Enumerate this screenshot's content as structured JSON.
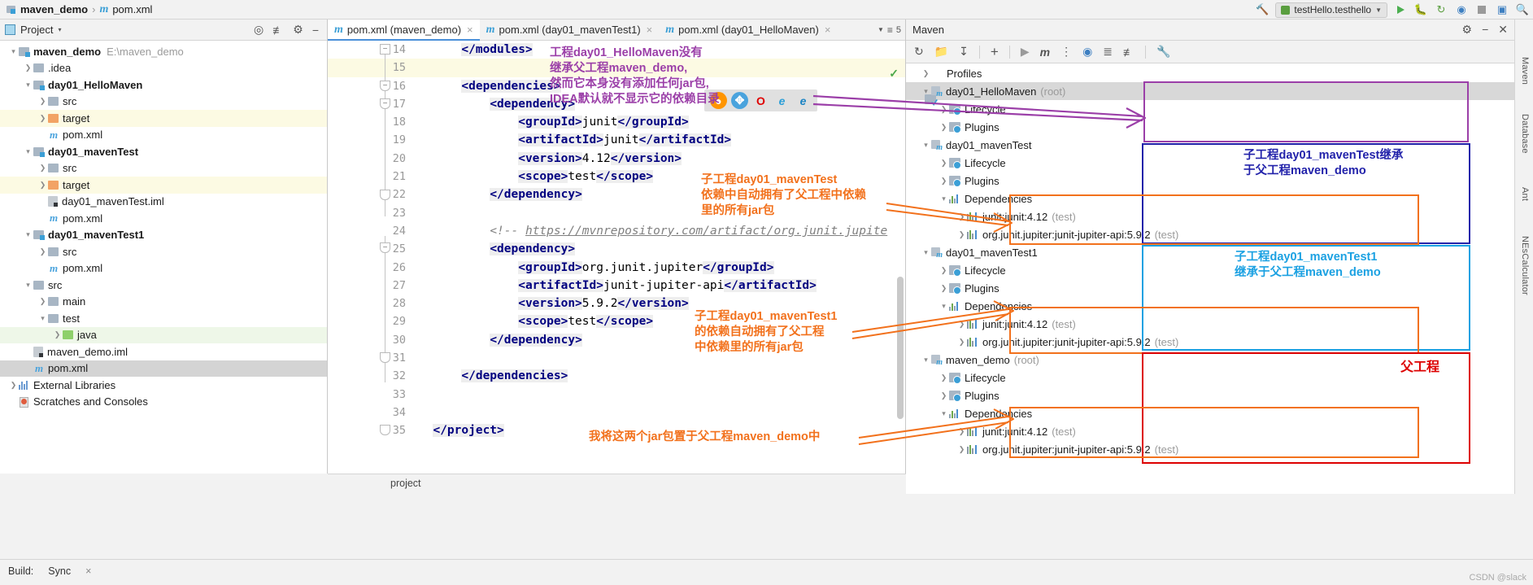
{
  "topbar": {
    "breadcrumb_project": "maven_demo",
    "breadcrumb_sep": "›",
    "breadcrumb_file": "pom.xml",
    "run_config": "testHello.testhello",
    "icons": [
      "hammer-icon",
      "run-button",
      "debug-button",
      "rerun-button",
      "coverage-button",
      "stop-button",
      "layout-button",
      "search-everywhere-icon"
    ]
  },
  "project_panel": {
    "title": "Project",
    "chevron": "▾",
    "tree": [
      {
        "indent": 0,
        "arrow": "v",
        "icon": "module",
        "label": "maven_demo",
        "bold": true,
        "path": "E:\\maven_demo",
        "hl": ""
      },
      {
        "indent": 1,
        "arrow": ">",
        "icon": "folder",
        "label": ".idea",
        "bold": false,
        "path": "",
        "hl": ""
      },
      {
        "indent": 1,
        "arrow": "v",
        "icon": "module",
        "label": "day01_HelloMaven",
        "bold": true,
        "path": "",
        "hl": ""
      },
      {
        "indent": 2,
        "arrow": ">",
        "icon": "folder",
        "label": "src",
        "bold": false,
        "path": "",
        "hl": ""
      },
      {
        "indent": 2,
        "arrow": ">",
        "icon": "folder-orange",
        "label": "target",
        "bold": false,
        "path": "",
        "hl": "yellow"
      },
      {
        "indent": 2,
        "arrow": "",
        "icon": "maven-file",
        "label": "pom.xml",
        "bold": false,
        "path": "",
        "hl": ""
      },
      {
        "indent": 1,
        "arrow": "v",
        "icon": "module",
        "label": "day01_mavenTest",
        "bold": true,
        "path": "",
        "hl": ""
      },
      {
        "indent": 2,
        "arrow": ">",
        "icon": "folder",
        "label": "src",
        "bold": false,
        "path": "",
        "hl": ""
      },
      {
        "indent": 2,
        "arrow": ">",
        "icon": "folder-orange",
        "label": "target",
        "bold": false,
        "path": "",
        "hl": "yellow"
      },
      {
        "indent": 2,
        "arrow": "",
        "icon": "iml-file",
        "label": "day01_mavenTest.iml",
        "bold": false,
        "path": "",
        "hl": ""
      },
      {
        "indent": 2,
        "arrow": "",
        "icon": "maven-file",
        "label": "pom.xml",
        "bold": false,
        "path": "",
        "hl": ""
      },
      {
        "indent": 1,
        "arrow": "v",
        "icon": "module",
        "label": "day01_mavenTest1",
        "bold": true,
        "path": "",
        "hl": ""
      },
      {
        "indent": 2,
        "arrow": ">",
        "icon": "folder",
        "label": "src",
        "bold": false,
        "path": "",
        "hl": ""
      },
      {
        "indent": 2,
        "arrow": "",
        "icon": "maven-file",
        "label": "pom.xml",
        "bold": false,
        "path": "",
        "hl": ""
      },
      {
        "indent": 1,
        "arrow": "v",
        "icon": "folder",
        "label": "src",
        "bold": false,
        "path": "",
        "hl": ""
      },
      {
        "indent": 2,
        "arrow": ">",
        "icon": "folder",
        "label": "main",
        "bold": false,
        "path": "",
        "hl": ""
      },
      {
        "indent": 2,
        "arrow": "v",
        "icon": "folder",
        "label": "test",
        "bold": false,
        "path": "",
        "hl": ""
      },
      {
        "indent": 3,
        "arrow": ">",
        "icon": "folder-green",
        "label": "java",
        "bold": false,
        "path": "",
        "hl": "green"
      },
      {
        "indent": 1,
        "arrow": "",
        "icon": "iml-file",
        "label": "maven_demo.iml",
        "bold": false,
        "path": "",
        "hl": ""
      },
      {
        "indent": 1,
        "arrow": "",
        "icon": "maven-file",
        "label": "pom.xml",
        "bold": false,
        "path": "",
        "hl": "sel"
      },
      {
        "indent": 0,
        "arrow": ">",
        "icon": "library",
        "label": "External Libraries",
        "bold": false,
        "path": "",
        "hl": ""
      },
      {
        "indent": 0,
        "arrow": "",
        "icon": "scratch",
        "label": "Scratches and Consoles",
        "bold": false,
        "path": "",
        "hl": ""
      }
    ]
  },
  "editor": {
    "tabs": [
      {
        "label": "pom.xml (maven_demo)",
        "active": true,
        "close": "×"
      },
      {
        "label": "pom.xml (day01_mavenTest1)",
        "active": false,
        "close": "×"
      },
      {
        "label": "pom.xml (day01_HelloMaven)",
        "active": false,
        "close": "×"
      }
    ],
    "tab_overflow_count": "5",
    "status_text": "project",
    "inspection_check": "✓",
    "browsers": [
      "firefox",
      "safari",
      "opera",
      "edge-legacy",
      "edge"
    ],
    "lines": [
      {
        "n": "14",
        "cur": false,
        "indent": 3,
        "segs": [
          {
            "t": "</modules>",
            "c": "tg",
            "bg": true
          }
        ]
      },
      {
        "n": "15",
        "cur": true,
        "indent": 0,
        "segs": []
      },
      {
        "n": "16",
        "cur": false,
        "indent": 3,
        "segs": [
          {
            "t": "<dependencies>",
            "c": "tg",
            "bg": true
          }
        ]
      },
      {
        "n": "17",
        "cur": false,
        "indent": 5,
        "segs": [
          {
            "t": "<dependency>",
            "c": "tg",
            "bg": true
          }
        ]
      },
      {
        "n": "18",
        "cur": false,
        "indent": 7,
        "segs": [
          {
            "t": "<groupId>",
            "c": "tg",
            "bg": true
          },
          {
            "t": "junit",
            "c": "txt",
            "bg": false
          },
          {
            "t": "</groupId>",
            "c": "tg",
            "bg": true
          }
        ]
      },
      {
        "n": "19",
        "cur": false,
        "indent": 7,
        "segs": [
          {
            "t": "<artifactId>",
            "c": "tg",
            "bg": true
          },
          {
            "t": "junit",
            "c": "txt",
            "bg": false
          },
          {
            "t": "</artifactId>",
            "c": "tg",
            "bg": true
          }
        ]
      },
      {
        "n": "20",
        "cur": false,
        "indent": 7,
        "segs": [
          {
            "t": "<version>",
            "c": "tg",
            "bg": true
          },
          {
            "t": "4.12",
            "c": "txt",
            "bg": false
          },
          {
            "t": "</version>",
            "c": "tg",
            "bg": true
          }
        ]
      },
      {
        "n": "21",
        "cur": false,
        "indent": 7,
        "segs": [
          {
            "t": "<scope>",
            "c": "tg",
            "bg": true
          },
          {
            "t": "test",
            "c": "txt",
            "bg": false
          },
          {
            "t": "</scope>",
            "c": "tg",
            "bg": true
          }
        ]
      },
      {
        "n": "22",
        "cur": false,
        "indent": 5,
        "segs": [
          {
            "t": "</dependency>",
            "c": "tg",
            "bg": true
          }
        ]
      },
      {
        "n": "23",
        "cur": false,
        "indent": 0,
        "segs": []
      },
      {
        "n": "24",
        "cur": false,
        "indent": 5,
        "segs": [
          {
            "t": "<!-- ",
            "c": "cmt",
            "bg": false
          },
          {
            "t": "https://mvnrepository.com/artifact/org.junit.jupite",
            "c": "lnk",
            "bg": false
          }
        ]
      },
      {
        "n": "25",
        "cur": false,
        "indent": 5,
        "segs": [
          {
            "t": "<dependency>",
            "c": "tg",
            "bg": true
          }
        ]
      },
      {
        "n": "26",
        "cur": false,
        "indent": 7,
        "segs": [
          {
            "t": "<groupId>",
            "c": "tg",
            "bg": true
          },
          {
            "t": "org.junit.jupiter",
            "c": "txt",
            "bg": false
          },
          {
            "t": "</groupId>",
            "c": "tg",
            "bg": true
          }
        ]
      },
      {
        "n": "27",
        "cur": false,
        "indent": 7,
        "segs": [
          {
            "t": "<artifactId>",
            "c": "tg",
            "bg": true
          },
          {
            "t": "junit-jupiter-api",
            "c": "txt",
            "bg": false
          },
          {
            "t": "</artifactId>",
            "c": "tg",
            "bg": true
          }
        ]
      },
      {
        "n": "28",
        "cur": false,
        "indent": 7,
        "segs": [
          {
            "t": "<version>",
            "c": "tg",
            "bg": true
          },
          {
            "t": "5.9.2",
            "c": "txt",
            "bg": false
          },
          {
            "t": "</version>",
            "c": "tg",
            "bg": true
          }
        ]
      },
      {
        "n": "29",
        "cur": false,
        "indent": 7,
        "segs": [
          {
            "t": "<scope>",
            "c": "tg",
            "bg": true
          },
          {
            "t": "test",
            "c": "txt",
            "bg": false
          },
          {
            "t": "</scope>",
            "c": "tg",
            "bg": true
          }
        ]
      },
      {
        "n": "30",
        "cur": false,
        "indent": 5,
        "segs": [
          {
            "t": "</dependency>",
            "c": "tg",
            "bg": true
          }
        ]
      },
      {
        "n": "31",
        "cur": false,
        "indent": 0,
        "segs": []
      },
      {
        "n": "32",
        "cur": false,
        "indent": 3,
        "segs": [
          {
            "t": "</dependencies>",
            "c": "tg",
            "bg": true
          }
        ]
      },
      {
        "n": "33",
        "cur": false,
        "indent": 0,
        "segs": []
      },
      {
        "n": "34",
        "cur": false,
        "indent": 0,
        "segs": []
      },
      {
        "n": "35",
        "cur": false,
        "indent": 1,
        "segs": [
          {
            "t": "</project>",
            "c": "tg",
            "bg": true
          }
        ]
      }
    ]
  },
  "maven_panel": {
    "title": "Maven",
    "toolbar_icons": [
      "reload-icon",
      "add-module-icon",
      "download-sources-icon",
      "plus-icon",
      "run-icon",
      "maven-goal-icon",
      "skip-tests-icon",
      "toggle-offline-icon",
      "expand-all-icon",
      "collapse-all-icon",
      "settings-wrench-icon"
    ],
    "tree": [
      {
        "indent": 0,
        "arrow": ">",
        "icon": "profiles",
        "label": "Profiles",
        "suffix": "",
        "sel": false
      },
      {
        "indent": 0,
        "arrow": "v",
        "icon": "module",
        "label": "day01_HelloMaven",
        "suffix": "(root)",
        "sel": true
      },
      {
        "indent": 1,
        "arrow": ">",
        "icon": "gear-folder",
        "label": "Lifecycle",
        "suffix": "",
        "sel": false
      },
      {
        "indent": 1,
        "arrow": ">",
        "icon": "gear-folder",
        "label": "Plugins",
        "suffix": "",
        "sel": false
      },
      {
        "indent": 0,
        "arrow": "v",
        "icon": "module",
        "label": "day01_mavenTest",
        "suffix": "",
        "sel": false
      },
      {
        "indent": 1,
        "arrow": ">",
        "icon": "gear-folder",
        "label": "Lifecycle",
        "suffix": "",
        "sel": false
      },
      {
        "indent": 1,
        "arrow": ">",
        "icon": "gear-folder",
        "label": "Plugins",
        "suffix": "",
        "sel": false
      },
      {
        "indent": 1,
        "arrow": "v",
        "icon": "deps-folder",
        "label": "Dependencies",
        "suffix": "",
        "sel": false
      },
      {
        "indent": 2,
        "arrow": ">",
        "icon": "jar",
        "label": "junit:junit:4.12",
        "suffix": "(test)",
        "sel": false
      },
      {
        "indent": 2,
        "arrow": ">",
        "icon": "jar",
        "label": "org.junit.jupiter:junit-jupiter-api:5.9.2",
        "suffix": "(test)",
        "sel": false
      },
      {
        "indent": 0,
        "arrow": "v",
        "icon": "module",
        "label": "day01_mavenTest1",
        "suffix": "",
        "sel": false
      },
      {
        "indent": 1,
        "arrow": ">",
        "icon": "gear-folder",
        "label": "Lifecycle",
        "suffix": "",
        "sel": false
      },
      {
        "indent": 1,
        "arrow": ">",
        "icon": "gear-folder",
        "label": "Plugins",
        "suffix": "",
        "sel": false
      },
      {
        "indent": 1,
        "arrow": "v",
        "icon": "deps-folder",
        "label": "Dependencies",
        "suffix": "",
        "sel": false
      },
      {
        "indent": 2,
        "arrow": ">",
        "icon": "jar",
        "label": "junit:junit:4.12",
        "suffix": "(test)",
        "sel": false
      },
      {
        "indent": 2,
        "arrow": ">",
        "icon": "jar",
        "label": "org.junit.jupiter:junit-jupiter-api:5.9.2",
        "suffix": "(test)",
        "sel": false
      },
      {
        "indent": 0,
        "arrow": "v",
        "icon": "module",
        "label": "maven_demo",
        "suffix": "(root)",
        "sel": false
      },
      {
        "indent": 1,
        "arrow": ">",
        "icon": "gear-folder",
        "label": "Lifecycle",
        "suffix": "",
        "sel": false
      },
      {
        "indent": 1,
        "arrow": ">",
        "icon": "gear-folder",
        "label": "Plugins",
        "suffix": "",
        "sel": false
      },
      {
        "indent": 1,
        "arrow": "v",
        "icon": "deps-folder",
        "label": "Dependencies",
        "suffix": "",
        "sel": false
      },
      {
        "indent": 2,
        "arrow": ">",
        "icon": "jar",
        "label": "junit:junit:4.12",
        "suffix": "(test)",
        "sel": false
      },
      {
        "indent": 2,
        "arrow": ">",
        "icon": "jar",
        "label": "org.junit.jupiter:junit-jupiter-api:5.9.2",
        "suffix": "(test)",
        "sel": false
      }
    ]
  },
  "annotations": {
    "purple_note": "工程day01_HelloMaven没有\n继承父工程maven_demo,\n然而它本身没有添加任何jar包,\nIDEA默认就不显示它的依赖目录",
    "orange_note_test": "子工程day01_mavenTest\n依赖中自动拥有了父工程中依赖\n里的所有jar包",
    "orange_note_test1": "子工程day01_mavenTest1\n的依赖自动拥有了父工程\n中依赖里的所有jar包",
    "orange_note_bottom": "我将这两个jar包置于父工程maven_demo中",
    "blue_note_test": "子工程day01_mavenTest继承\n于父工程maven_demo",
    "blue_note_test1": "子工程day01_mavenTest1\n继承于父工程maven_demo",
    "red_note_parent": "父工程",
    "colors": {
      "purple": "#9b3fa8",
      "orange": "#f2711c",
      "blue_dark": "#2222aa",
      "blue_light": "#1ba1e2",
      "red": "#dd0000"
    }
  },
  "bottombar": {
    "items": [
      "Build:",
      "Sync"
    ],
    "close": "×",
    "watermark": "CSDN @slack"
  },
  "right_strip": {
    "labels": [
      "Maven",
      "Database",
      "Ant",
      "NEsCalculator"
    ]
  }
}
